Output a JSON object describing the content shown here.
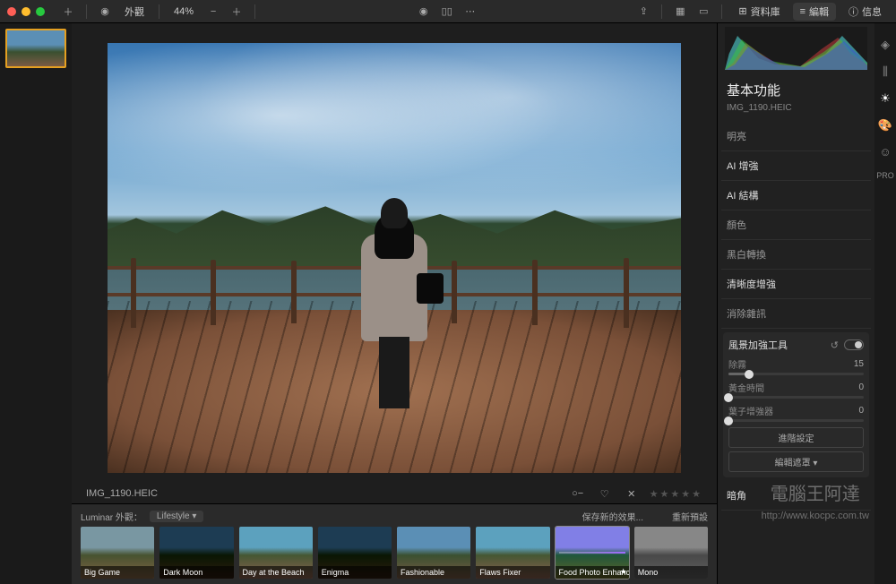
{
  "toolbar": {
    "appearance_label": "外觀",
    "zoom": "44%",
    "library_label": "資料庫",
    "edit_label": "編輯",
    "info_label": "信息"
  },
  "file": {
    "name": "IMG_1190.HEIC"
  },
  "presets": {
    "header": "Luminar 外觀：",
    "category": "Lifestyle",
    "save_label": "保存新的效果...",
    "reset_label": "重新預設",
    "items": [
      {
        "label": "Big Game"
      },
      {
        "label": "Dark Moon"
      },
      {
        "label": "Day at the Beach"
      },
      {
        "label": "Enigma"
      },
      {
        "label": "Fashionable"
      },
      {
        "label": "Flaws Fixer"
      },
      {
        "label": "Food Photo Enhancer"
      },
      {
        "label": "Mono"
      }
    ]
  },
  "panel": {
    "title": "基本功能",
    "subtitle": "IMG_1190.HEIC",
    "items": [
      {
        "label": "明亮",
        "bright": false
      },
      {
        "label": "AI 增強",
        "bright": true
      },
      {
        "label": "AI 結構",
        "bright": true
      },
      {
        "label": "顏色",
        "bright": false
      },
      {
        "label": "黑白轉換",
        "bright": false
      },
      {
        "label": "清晰度增強",
        "bright": true
      },
      {
        "label": "消除雜訊",
        "bright": false
      }
    ],
    "open_tool": {
      "name": "風景加強工具",
      "sliders": [
        {
          "label": "除霧",
          "value": 15
        },
        {
          "label": "黃金時間",
          "value": 0
        },
        {
          "label": "葉子增強器",
          "value": 0
        }
      ],
      "advanced": "進階設定",
      "mask": "編輯遮罩"
    },
    "last_item": "暗角"
  },
  "right_tools": {
    "pro_label": "PRO"
  },
  "watermark": {
    "line1": "電腦王阿達",
    "line2": "http://www.kocpc.com.tw"
  }
}
